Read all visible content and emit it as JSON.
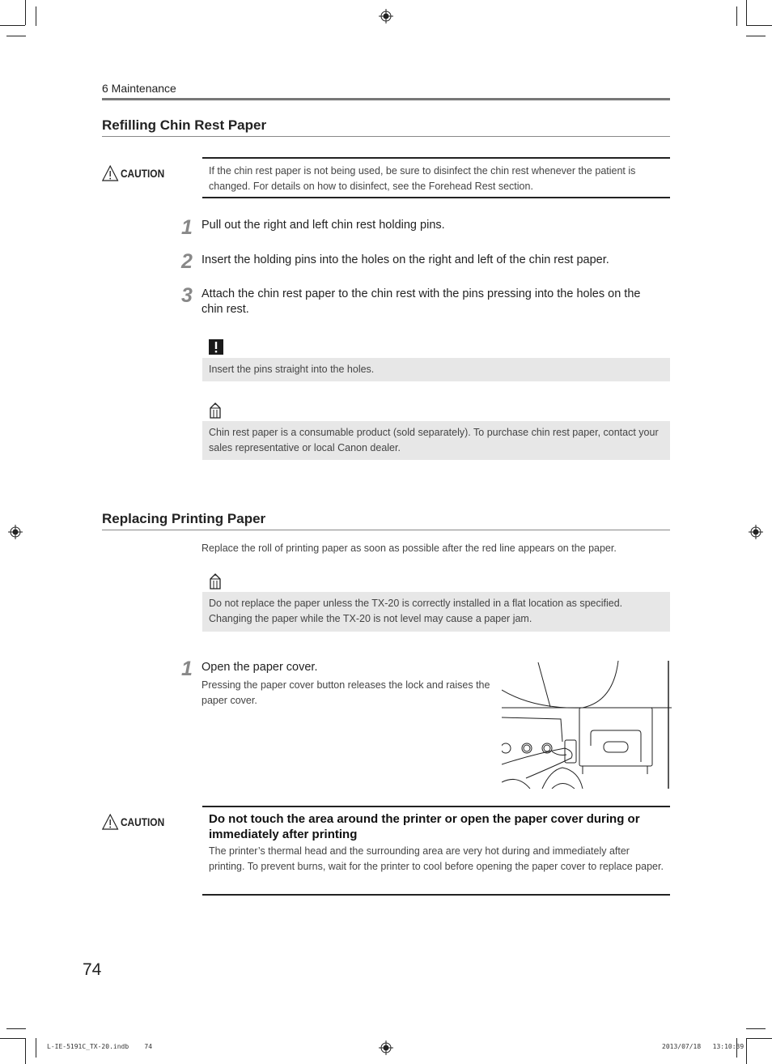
{
  "running_head": "6 Maintenance",
  "page_number": "74",
  "sections": [
    {
      "title": "Refilling Chin Rest Paper",
      "caution": {
        "label": "CAUTION",
        "text": "If the chin rest paper is not being used, be sure to disinfect the chin rest whenever the patient is changed. For details on how to disinfect, see the Forehead Rest section."
      },
      "steps": [
        {
          "num": "1",
          "text": "Pull out the right and left chin rest holding pins."
        },
        {
          "num": "2",
          "text": "Insert the holding pins into the holes on the right and left of the chin rest paper."
        },
        {
          "num": "3",
          "text": "Attach the chin rest paper to the chin rest with the pins pressing into the holes on the chin rest."
        }
      ],
      "important_note": {
        "icon": "exclamation-icon",
        "text": "Insert the pins straight into the holes."
      },
      "memo_note": {
        "icon": "pencil-icon",
        "text": "Chin rest paper is a consumable product (sold separately). To purchase chin rest paper, contact your sales representative or local Canon dealer."
      }
    },
    {
      "title": "Replacing Printing Paper",
      "intro": "Replace the roll of printing paper as soon as possible after the red line appears on the paper.",
      "memo_note": {
        "icon": "pencil-icon",
        "text": "Do not replace the paper unless the TX-20 is correctly installed in a flat location as specified. Changing the paper while the TX-20 is not level may cause a paper jam."
      },
      "steps": [
        {
          "num": "1",
          "text": "Open the paper cover.",
          "detail": "Pressing the paper cover button releases the lock and raises the paper cover."
        }
      ],
      "illustration": "finger pressing paper cover button on printer",
      "caution": {
        "label": "CAUTION",
        "headline": "Do not touch the area around the printer or open the paper cover during or immediately after printing",
        "text": "The printer’s thermal head and the surrounding area are very hot during and immediately after printing. To prevent burns, wait for the printer to cool before opening the paper cover to replace paper."
      }
    }
  ],
  "slug": {
    "file": "L-IE-5191C_TX-20.indb",
    "page": "74",
    "date": "2013/07/18",
    "time": "13:10:39"
  }
}
